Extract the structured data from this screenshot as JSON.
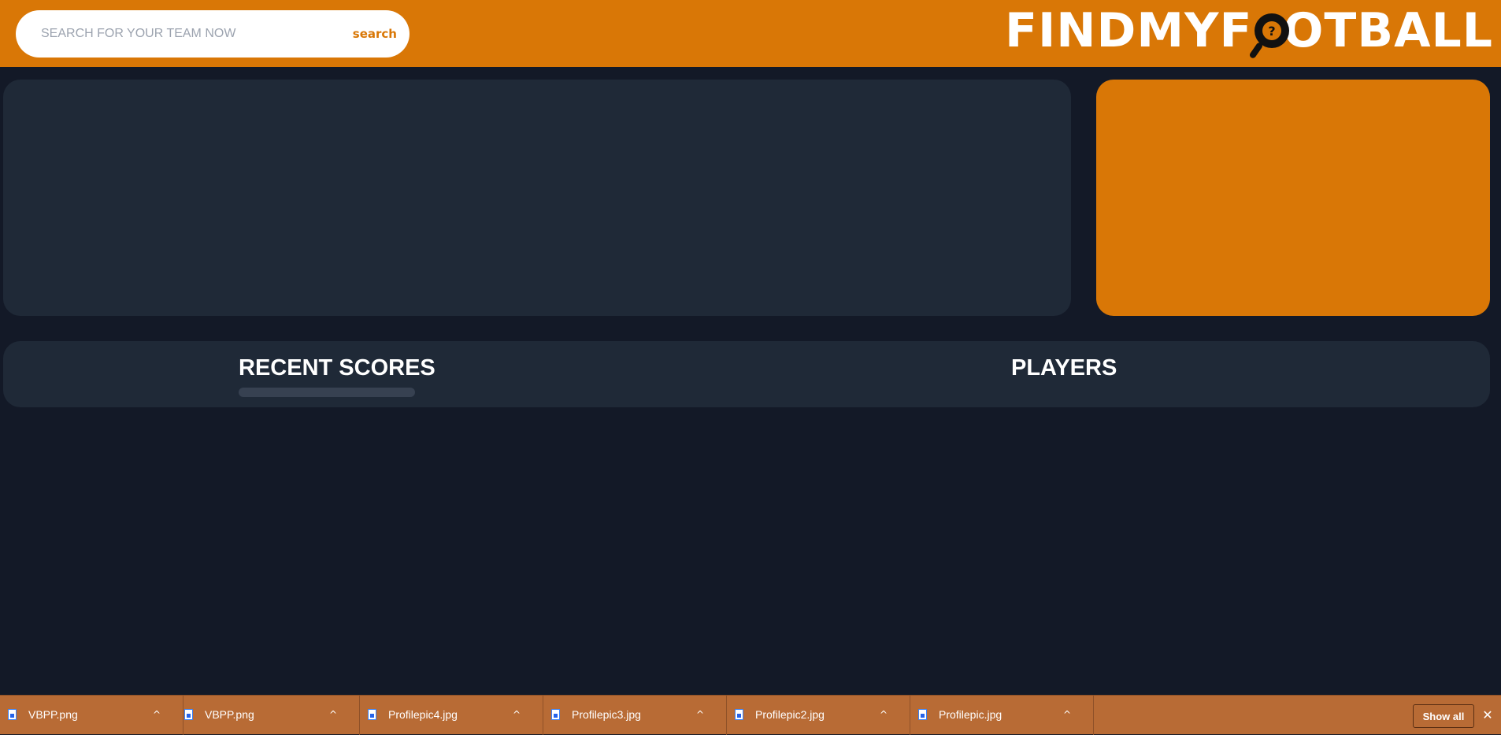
{
  "header": {
    "search_placeholder": "SEARCH FOR YOUR TEAM NOW",
    "search_button": "search",
    "logo_left": "FINDMYF",
    "logo_right": "OTBALL",
    "logo_mark": "?",
    "logo_icon": "magnifier-football-icon"
  },
  "tabs": [
    {
      "label": "RECENT SCORES",
      "active": true
    },
    {
      "label": "PLAYERS",
      "active": false
    }
  ],
  "downloads": {
    "items": [
      {
        "name": "VBPP.png"
      },
      {
        "name": "VBPP.png"
      },
      {
        "name": "Profilepic4.jpg"
      },
      {
        "name": "Profilepic3.jpg"
      },
      {
        "name": "Profilepic2.jpg"
      },
      {
        "name": "Profilepic.jpg"
      }
    ],
    "show_all": "Show all",
    "chevron": "^",
    "close": "✕"
  },
  "colors": {
    "accent": "#d97706",
    "background": "#131927",
    "panel": "#1f2937",
    "downloads_bar": "#b86b35"
  }
}
